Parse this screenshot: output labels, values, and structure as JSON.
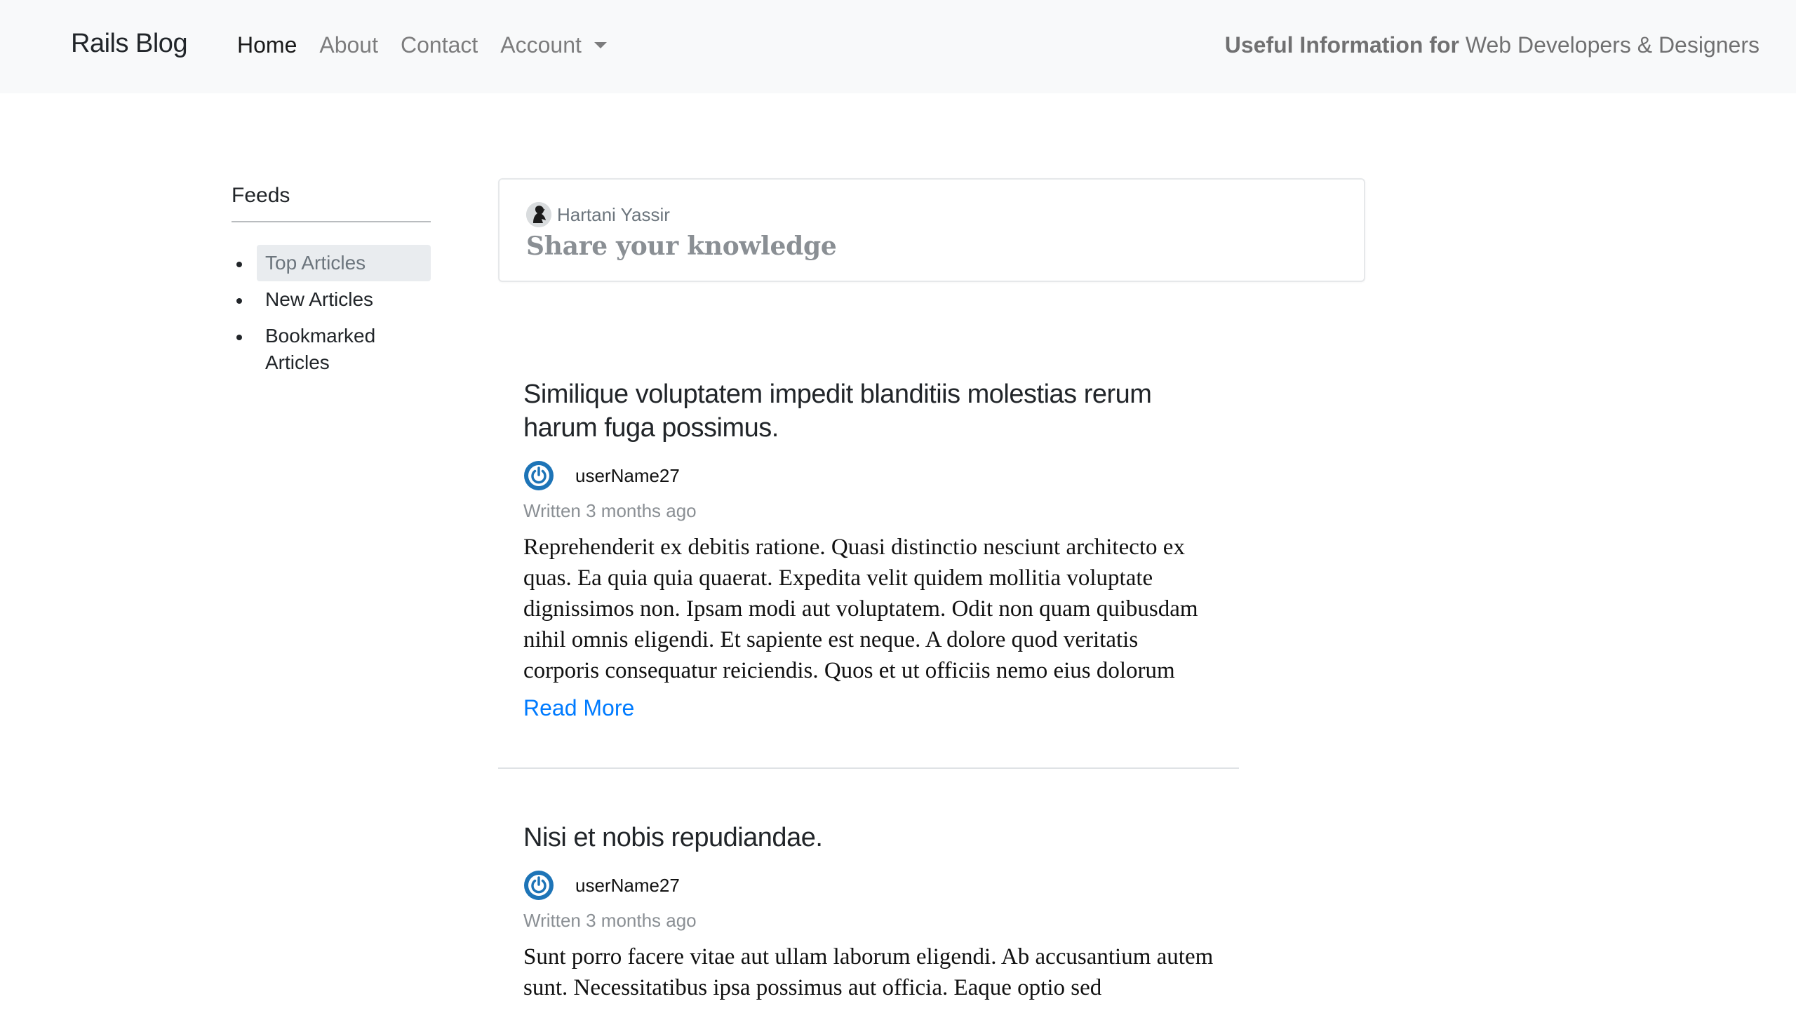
{
  "navbar": {
    "brand": "Rails Blog",
    "links": [
      {
        "label": "Home",
        "active": true
      },
      {
        "label": "About",
        "active": false
      },
      {
        "label": "Contact",
        "active": false
      },
      {
        "label": "Account",
        "active": false,
        "dropdown": true
      }
    ],
    "tagline_bold": "Useful Information for",
    "tagline_rest": "Web Developers & Designers"
  },
  "sidebar": {
    "title": "Feeds",
    "items": [
      {
        "label": "Top Articles",
        "active": true
      },
      {
        "label": "New Articles",
        "active": false
      },
      {
        "label": "Bookmarked Articles",
        "active": false
      }
    ]
  },
  "share": {
    "author": "Hartani Yassir",
    "prompt": "Share your knowledge",
    "avatar_icon": "user-avatar-icon"
  },
  "articles": [
    {
      "title": "Similique voluptatem impedit blanditiis molestias rerum harum fuga possimus.",
      "author": "userName27",
      "written": "Written 3 months ago",
      "excerpt": "Reprehenderit ex debitis ratione. Quasi distinctio nesciunt architecto ex quas. Ea quia quia quaerat. Expedita velit quidem mollitia voluptate dignissimos non. Ipsam modi aut voluptatem. Odit non quam quibusdam nihil omnis eligendi. Et sapiente est neque. A dolore quod veritatis corporis consequatur reiciendis. Quos et ut officiis nemo eius dolorum ullam. Officia velit accusantium.",
      "read_more": "Read More"
    },
    {
      "title": "Nisi et nobis repudiandae.",
      "author": "userName27",
      "written": "Written 3 months ago",
      "excerpt": "Sunt porro facere vitae aut ullam laborum eligendi. Ab accusantium autem sunt. Necessitatibus ipsa possimus aut officia. Eaque optio sed"
    }
  ],
  "colors": {
    "navbar_bg": "#f8f9fa",
    "link_blue": "#007bff",
    "muted": "#6c757d",
    "author_avatar": "#1d74b7"
  }
}
